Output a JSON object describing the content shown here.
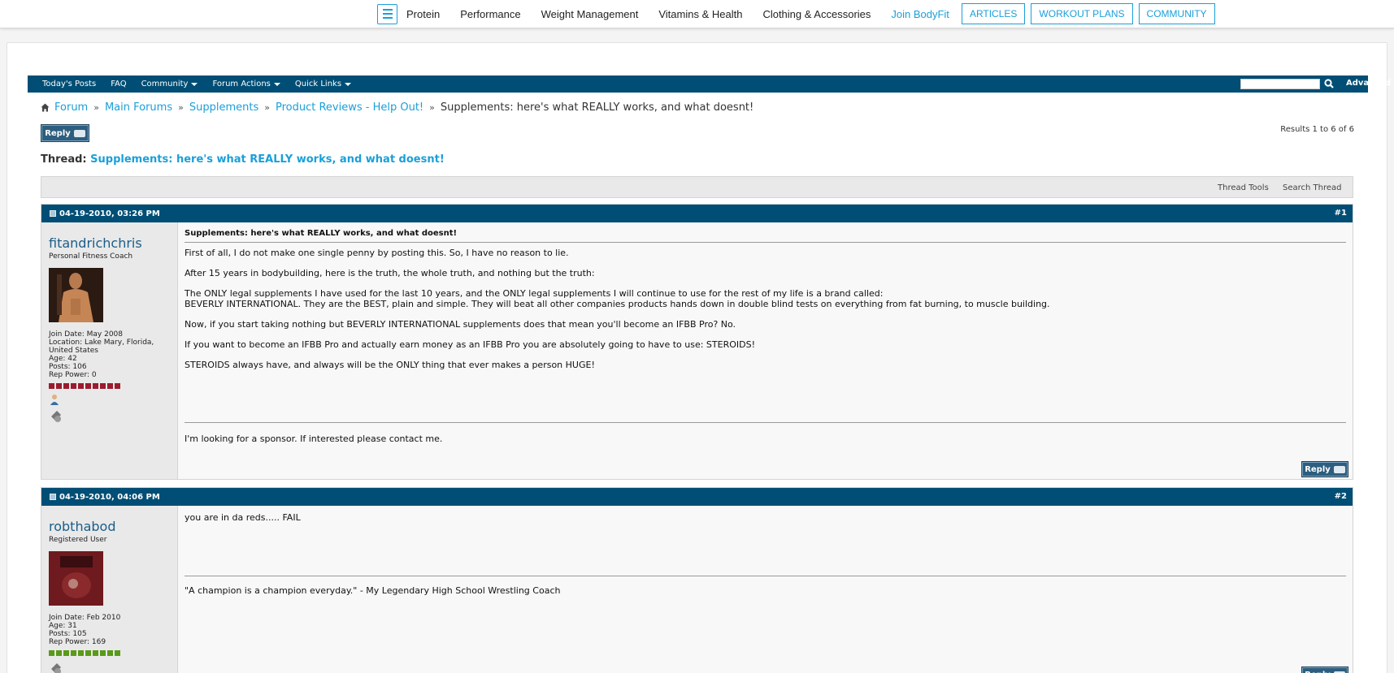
{
  "site_nav": {
    "menu_icon": "hamburger-menu-icon",
    "links": [
      "Protein",
      "Performance",
      "Weight Management",
      "Vitamins & Health",
      "Clothing & Accessories"
    ],
    "join": "Join BodyFit",
    "buttons": [
      "ARTICLES",
      "WORKOUT PLANS",
      "COMMUNITY"
    ],
    "accent_color": "#1a9fd9"
  },
  "forum_nav": {
    "items": [
      "Today's Posts",
      "FAQ",
      "Community",
      "Forum Actions",
      "Quick Links"
    ],
    "dropdowns": [
      false,
      false,
      true,
      true,
      true
    ],
    "search_value": "",
    "search_icon": "search-icon",
    "advanced": "Advanced",
    "bar_color": "#004e75"
  },
  "breadcrumb": {
    "home_icon": "home-icon",
    "crumbs": [
      "Forum",
      "Main Forums",
      "Supplements",
      "Product Reviews - Help Out!"
    ],
    "current": "Supplements: here's what REALLY works, and what doesnt!",
    "separator": "»"
  },
  "reply_label": "Reply",
  "results": "Results 1 to 6 of 6",
  "thread": {
    "label": "Thread:",
    "title": "Supplements: here's what REALLY works, and what doesnt!"
  },
  "tools": {
    "thread_tools": "Thread Tools",
    "search_thread": "Search Thread"
  },
  "posts": [
    {
      "date": "04-19-2010, 03:26 PM",
      "number": "#1",
      "username": "fitandrichchris",
      "user_title": "Personal Fitness Coach",
      "details": [
        "Join Date: May 2008",
        "Location: Lake Mary, Florida, United States",
        "Age: 42",
        "Posts: 106",
        "Rep Power: 0"
      ],
      "rep_color": "#9b1c2e",
      "title": "Supplements: here's what REALLY works, and what doesnt!",
      "body": [
        "First of all, I do not make one single penny by posting this. So, I have no reason to lie.",
        "After 15 years in bodybuilding, here is the truth, the whole truth, and nothing but the truth:",
        "The ONLY legal supplements I have used for the last 10 years, and the ONLY legal supplements I will continue to use for the rest of my life is a brand called:",
        "BEVERLY INTERNATIONAL. They are the BEST, plain and simple. They will beat all other companies products hands down in double blind tests on everything from fat burning, to muscle building.",
        "Now, if you start taking nothing but BEVERLY INTERNATIONAL supplements does that mean you'll become an IFBB Pro? No.",
        "If you want to become an IFBB Pro and actually earn money as an IFBB Pro you are absolutely going to have to use: STEROIDS!",
        "STEROIDS always have, and always will be the ONLY thing that ever makes a person HUGE!"
      ],
      "signature": "I'm looking for a sponsor. If interested please contact me."
    },
    {
      "date": "04-19-2010, 04:06 PM",
      "number": "#2",
      "username": "robthabod",
      "user_title": "Registered User",
      "details": [
        "Join Date: Feb 2010",
        "Age: 31",
        "Posts: 105",
        "Rep Power: 169"
      ],
      "rep_color": "#5a9a1a",
      "body": [
        "you are in da reds..... FAIL"
      ],
      "signature": "\"A champion is a champion everyday.\" - My Legendary High School Wrestling Coach"
    }
  ]
}
